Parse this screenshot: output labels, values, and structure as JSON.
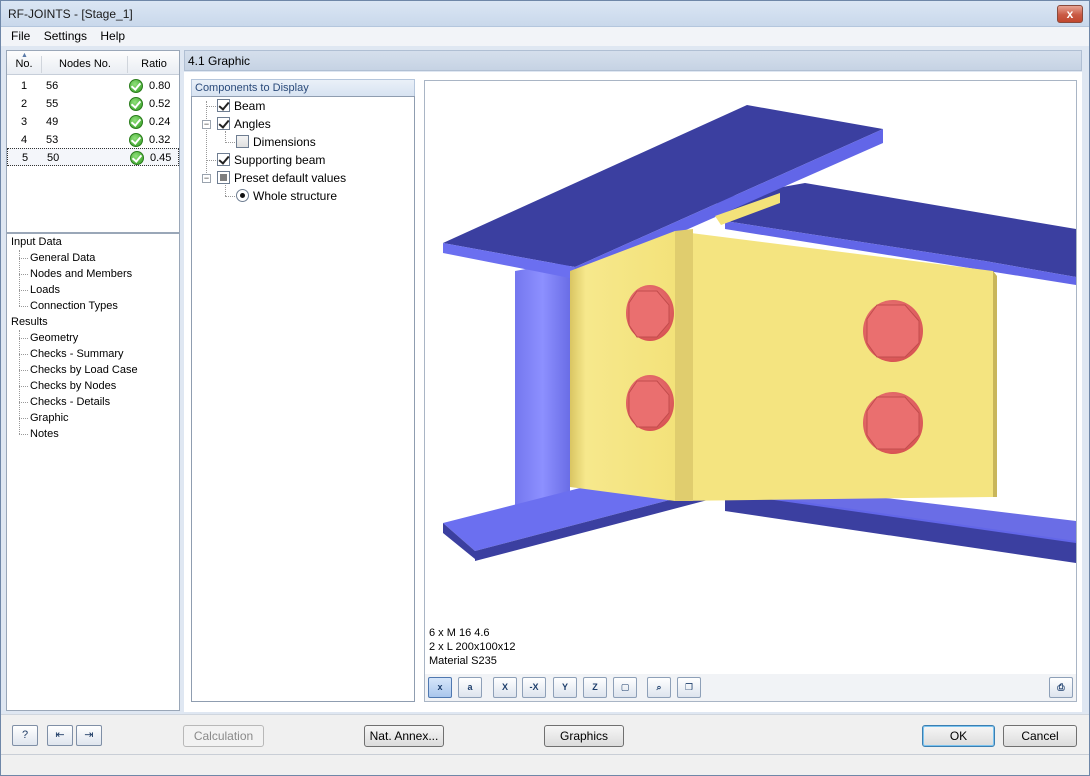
{
  "window": {
    "title": "RF-JOINTS - [Stage_1]",
    "close": "x"
  },
  "menu": [
    "File",
    "Settings",
    "Help"
  ],
  "grid": {
    "headers": {
      "no": "No.",
      "nodes": "Nodes No.",
      "ratio": "Ratio"
    },
    "rows": [
      {
        "no": "1",
        "nodes": "56",
        "ratio": "0.80"
      },
      {
        "no": "2",
        "nodes": "55",
        "ratio": "0.52"
      },
      {
        "no": "3",
        "nodes": "49",
        "ratio": "0.24"
      },
      {
        "no": "4",
        "nodes": "53",
        "ratio": "0.32"
      },
      {
        "no": "5",
        "nodes": "50",
        "ratio": "0.45"
      }
    ],
    "selected_row": 5
  },
  "nav": {
    "input_data": "Input Data",
    "input_items": [
      "General Data",
      "Nodes and Members",
      "Loads",
      "Connection Types"
    ],
    "results": "Results",
    "result_items": [
      "Geometry",
      "Checks - Summary",
      "Checks by Load Case",
      "Checks by Nodes",
      "Checks - Details",
      "Graphic",
      "Notes"
    ]
  },
  "section": {
    "title": "4.1 Graphic"
  },
  "components": {
    "tab_label": "Components to Display",
    "beam": "Beam",
    "angles": "Angles",
    "dimensions": "Dimensions",
    "supporting_beam": "Supporting beam",
    "preset": "Preset default values",
    "whole_structure": "Whole structure"
  },
  "graphic": {
    "info": [
      "6 x M 16 4.6",
      "2 x L 200x100x12",
      "Material S235"
    ],
    "colors": {
      "beam": "#3b3fa0",
      "beam_web": "#6b6ff0",
      "angle": "#f3e27a",
      "bolt": "#e86a6a"
    },
    "toolbar": [
      "x",
      "a",
      "X",
      "-X",
      "Y",
      "Z",
      "iso",
      "zoom",
      "copy",
      "print"
    ]
  },
  "buttons": {
    "calculation": "Calculation",
    "nat_annex": "Nat. Annex...",
    "graphics": "Graphics",
    "ok": "OK",
    "cancel": "Cancel"
  },
  "bottom_icons": [
    "help-icon",
    "export-icon",
    "import-icon"
  ]
}
